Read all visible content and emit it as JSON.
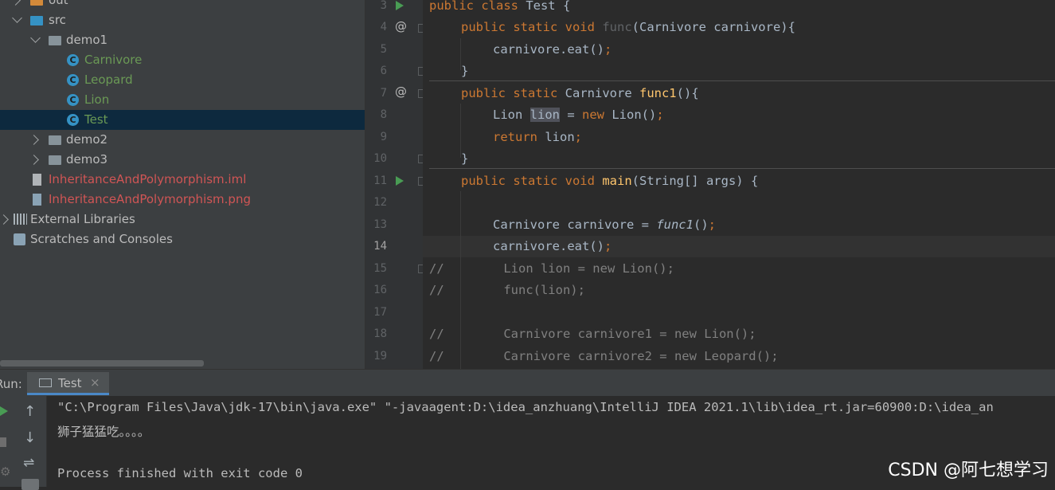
{
  "project_tree": {
    "items": [
      {
        "label": "out"
      },
      {
        "label": "src"
      },
      {
        "label": "demo1"
      },
      {
        "label": "Carnivore"
      },
      {
        "label": "Leopard"
      },
      {
        "label": "Lion"
      },
      {
        "label": "Test"
      },
      {
        "label": "demo2"
      },
      {
        "label": "demo3"
      },
      {
        "label": "InheritanceAndPolymorphism.iml"
      },
      {
        "label": "InheritanceAndPolymorphism.png"
      },
      {
        "label": "External Libraries"
      },
      {
        "label": "Scratches and Consoles"
      }
    ],
    "class_icon_letter": "C"
  },
  "editor": {
    "line_numbers": [
      "3",
      "4",
      "5",
      "6",
      "7",
      "8",
      "9",
      "10",
      "11",
      "12",
      "13",
      "14",
      "15",
      "16",
      "17",
      "18",
      "19"
    ],
    "current_line": "14",
    "code": {
      "l3": {
        "kw1": "public class",
        "rest": " Test {"
      },
      "l4": {
        "kw1": "public static void",
        "sp": " ",
        "fn": "func",
        "rest": "(Carnivore carnivore){"
      },
      "l5": {
        "rest": "carnivore.eat()",
        "semi": ";"
      },
      "l6": {
        "rest": "}"
      },
      "l7": {
        "kw1": "public static",
        "mid": " Carnivore ",
        "fn": "func1",
        "rest": "(){"
      },
      "l8": {
        "a": "Lion ",
        "hl": "lion",
        "b": " = ",
        "kw": "new",
        "c": " Lion()",
        "semi": ";"
      },
      "l9": {
        "kw": "return",
        "rest": " lion",
        "semi": ";"
      },
      "l10": {
        "rest": "}"
      },
      "l11": {
        "kw1": "public static void",
        "sp": " ",
        "fn": "main",
        "rest": "(String[] args) {"
      },
      "l13": {
        "a": "Carnivore carnivore = ",
        "it": "func1",
        "b": "()",
        "semi": ";"
      },
      "l14": {
        "rest": "carnivore.eat()",
        "semi": ";"
      },
      "l15": {
        "rest": "//        Lion lion = new Lion();"
      },
      "l16": {
        "rest": "//        func(lion);"
      },
      "l18": {
        "rest": "//        Carnivore carnivore1 = new Lion();"
      },
      "l19": {
        "rest": "//        Carnivore carnivore2 = new Leopard();"
      }
    },
    "gutter_marker": "@"
  },
  "run_panel": {
    "label": "Run:",
    "tab": "Test",
    "tab_close": "×",
    "console_lines": [
      "\"C:\\Program Files\\Java\\jdk-17\\bin\\java.exe\" \"-javaagent:D:\\idea_anzhuang\\IntelliJ IDEA 2021.1\\lib\\idea_rt.jar=60900:D:\\idea_an",
      "狮子猛猛吃。。。。",
      "",
      "Process finished with exit code 0"
    ]
  },
  "watermark": "CSDN @阿七想学习",
  "colors": {
    "folder": "#87939a",
    "folder_out": "#d38a3a",
    "class_label": "#6a9955",
    "error_file": "#d05555",
    "run_green": "#499c54"
  }
}
